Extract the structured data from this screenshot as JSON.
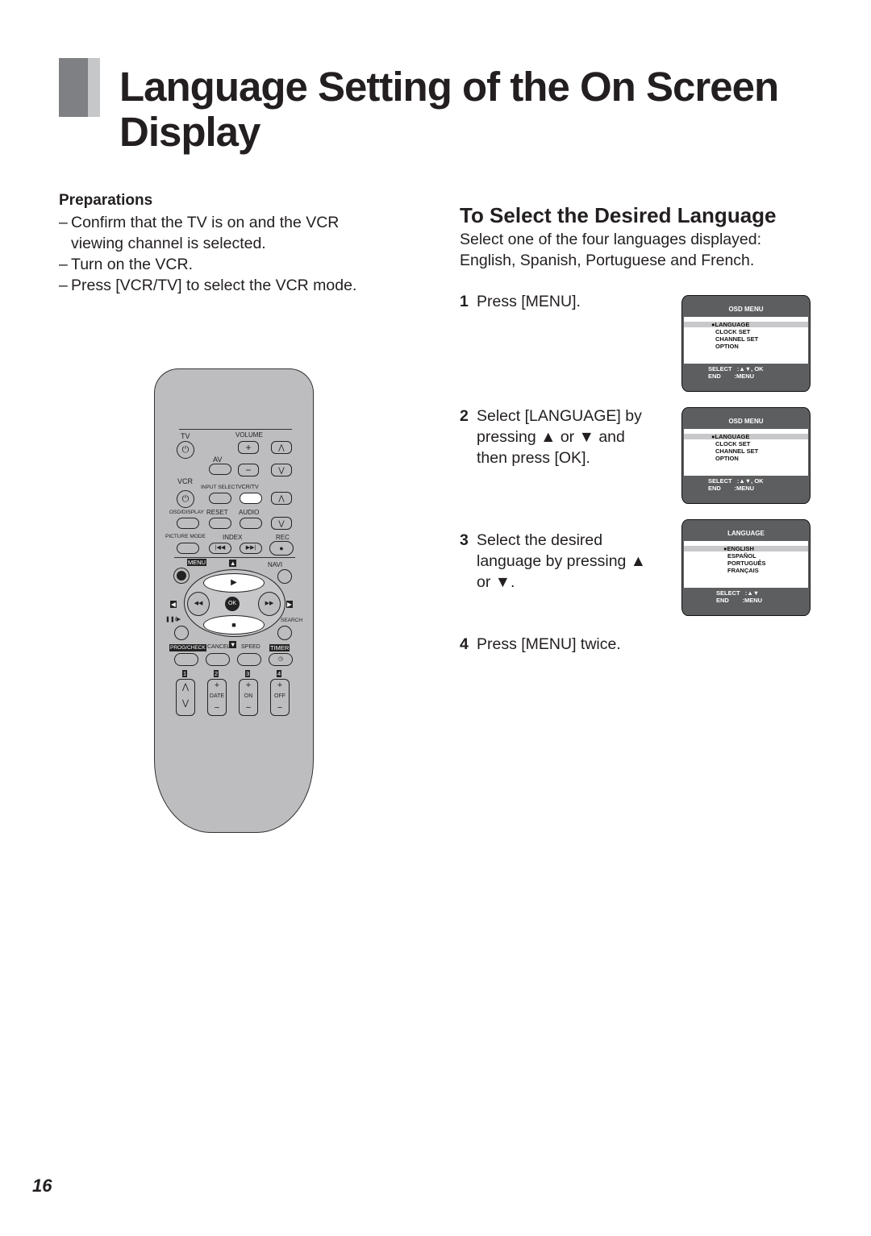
{
  "page": {
    "title": "Language Setting of the On Screen Display",
    "page_number": "16"
  },
  "preparations": {
    "heading": "Preparations",
    "items": [
      "Confirm that the TV is on and the VCR",
      "viewing channel is selected.",
      "Turn on the VCR.",
      "Press [VCR/TV] to select the VCR mode."
    ]
  },
  "section": {
    "heading": "To Select the Desired Language",
    "intro_1": "Select one of the four languages displayed:",
    "intro_2": "English, Spanish, Portuguese and French.",
    "steps": [
      {
        "num": "1",
        "lines": [
          "Press [MENU]."
        ]
      },
      {
        "num": "2",
        "lines": [
          "Select [LANGUAGE] by",
          "pressing ▲ or ▼ and",
          "then press [OK]."
        ]
      },
      {
        "num": "3",
        "lines": [
          "Select the desired",
          "language by pressing ▲",
          "or ▼."
        ]
      },
      {
        "num": "4",
        "lines": [
          "Press [MENU] twice."
        ]
      }
    ]
  },
  "osd_screens": [
    {
      "header": "OSD MENU",
      "items": [
        "●LANGUAGE",
        "CLOCK SET",
        "CHANNEL SET",
        "OPTION"
      ],
      "footer": [
        "SELECT   :▲▼, OK",
        "END        :MENU"
      ]
    },
    {
      "header": "OSD MENU",
      "items": [
        "●LANGUAGE",
        "CLOCK SET",
        "CHANNEL SET",
        "OPTION"
      ],
      "footer": [
        "SELECT   :▲▼, OK",
        "END        :MENU"
      ]
    },
    {
      "header": "LANGUAGE",
      "items": [
        "●ENGLISH",
        "ESPAÑOL",
        "PORTUGUÊS",
        "FRANÇAIS"
      ],
      "footer": [
        "SELECT   :▲▼",
        "END        :MENU"
      ]
    }
  ],
  "remote": {
    "labels": {
      "tv": "TV",
      "volume": "VOLUME",
      "av": "AV",
      "vcr": "VCR",
      "input_select": "INPUT SELECT",
      "vcr_tv": "VCR/TV",
      "osd_display": "OSD/DISPLAY",
      "reset": "RESET",
      "audio": "AUDIO",
      "picture_mode": "PICTURE MODE",
      "index": "INDEX",
      "rec": "REC",
      "menu": "MENU",
      "navi": "NAVI",
      "ok": "OK",
      "search": "SEARCH",
      "prog_check": "PROG/CHECK",
      "cancel": "CANCEL",
      "speed": "SPEED",
      "timer": "TIMER",
      "n1": "1",
      "n2": "2",
      "n3": "3",
      "n4": "4",
      "date": "DATE",
      "on": "ON",
      "off": "OFF",
      "pause": "❚❚/▶",
      "rew": "◀◀",
      "ff": "▶▶",
      "play": "▶",
      "stop": "■",
      "up": "▲",
      "down": "▼",
      "left": "◀",
      "right": "▶",
      "plus": "+",
      "minus": "−"
    }
  }
}
